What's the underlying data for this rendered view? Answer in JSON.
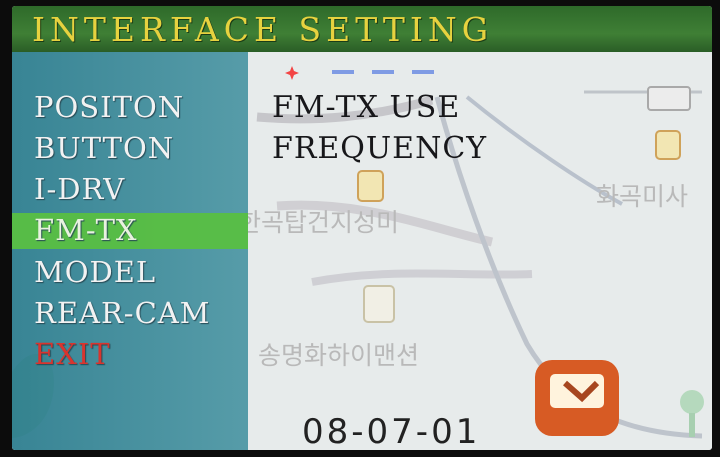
{
  "header": {
    "title": "INTERFACE SETTING"
  },
  "menu": {
    "items": [
      {
        "label": "POSITON"
      },
      {
        "label": "BUTTON"
      },
      {
        "label": "I-DRV"
      },
      {
        "label": "FM-TX"
      },
      {
        "label": "MODEL"
      },
      {
        "label": "REAR-CAM"
      },
      {
        "label": "EXIT"
      }
    ],
    "selected_index": 3
  },
  "options": {
    "fm_tx_use": "FM-TX USE",
    "frequency": "FREQUENCY"
  },
  "status": {
    "date": "08-07-01"
  },
  "map": {
    "labels": [
      "한곡탑건지성미",
      "화곡미사",
      "송명화하이맨션"
    ]
  },
  "colors": {
    "title_bar": "#3f7f35",
    "title_text": "#e7d23f",
    "menu_background": "#2f7f90",
    "selection": "#59bf42",
    "exit_text": "#d9342e",
    "map_background": "#e7ebeb"
  }
}
